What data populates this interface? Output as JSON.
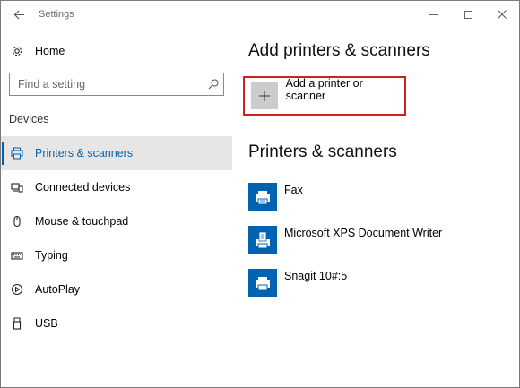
{
  "window": {
    "title": "Settings",
    "back_icon": "back-arrow-icon",
    "controls": [
      "minimize-icon",
      "maximize-icon",
      "close-icon"
    ]
  },
  "sidebar": {
    "home": {
      "label": "Home",
      "icon": "gear-icon"
    },
    "search": {
      "placeholder": "Find a setting",
      "icon": "search-icon"
    },
    "group_title": "Devices",
    "items": [
      {
        "label": "Printers & scanners",
        "icon": "printer-icon",
        "active": true
      },
      {
        "label": "Connected devices",
        "icon": "connected-devices-icon",
        "active": false
      },
      {
        "label": "Mouse & touchpad",
        "icon": "mouse-icon",
        "active": false
      },
      {
        "label": "Typing",
        "icon": "keyboard-icon",
        "active": false
      },
      {
        "label": "AutoPlay",
        "icon": "autoplay-icon",
        "active": false
      },
      {
        "label": "USB",
        "icon": "usb-icon",
        "active": false
      }
    ]
  },
  "main": {
    "add_heading": "Add printers & scanners",
    "add_button": {
      "label": "Add a printer or scanner",
      "icon": "plus-icon"
    },
    "list_heading": "Printers & scanners",
    "printers": [
      {
        "name": "Fax",
        "icon": "fax-printer-icon"
      },
      {
        "name": "Microsoft XPS Document Writer",
        "icon": "document-printer-icon"
      },
      {
        "name": "Snagit 10#:5",
        "icon": "printer-icon"
      }
    ]
  },
  "colors": {
    "accent": "#0063b1",
    "highlight_border": "#d02020",
    "active_bg": "#e6e6e6",
    "add_tile": "#cccccc"
  }
}
